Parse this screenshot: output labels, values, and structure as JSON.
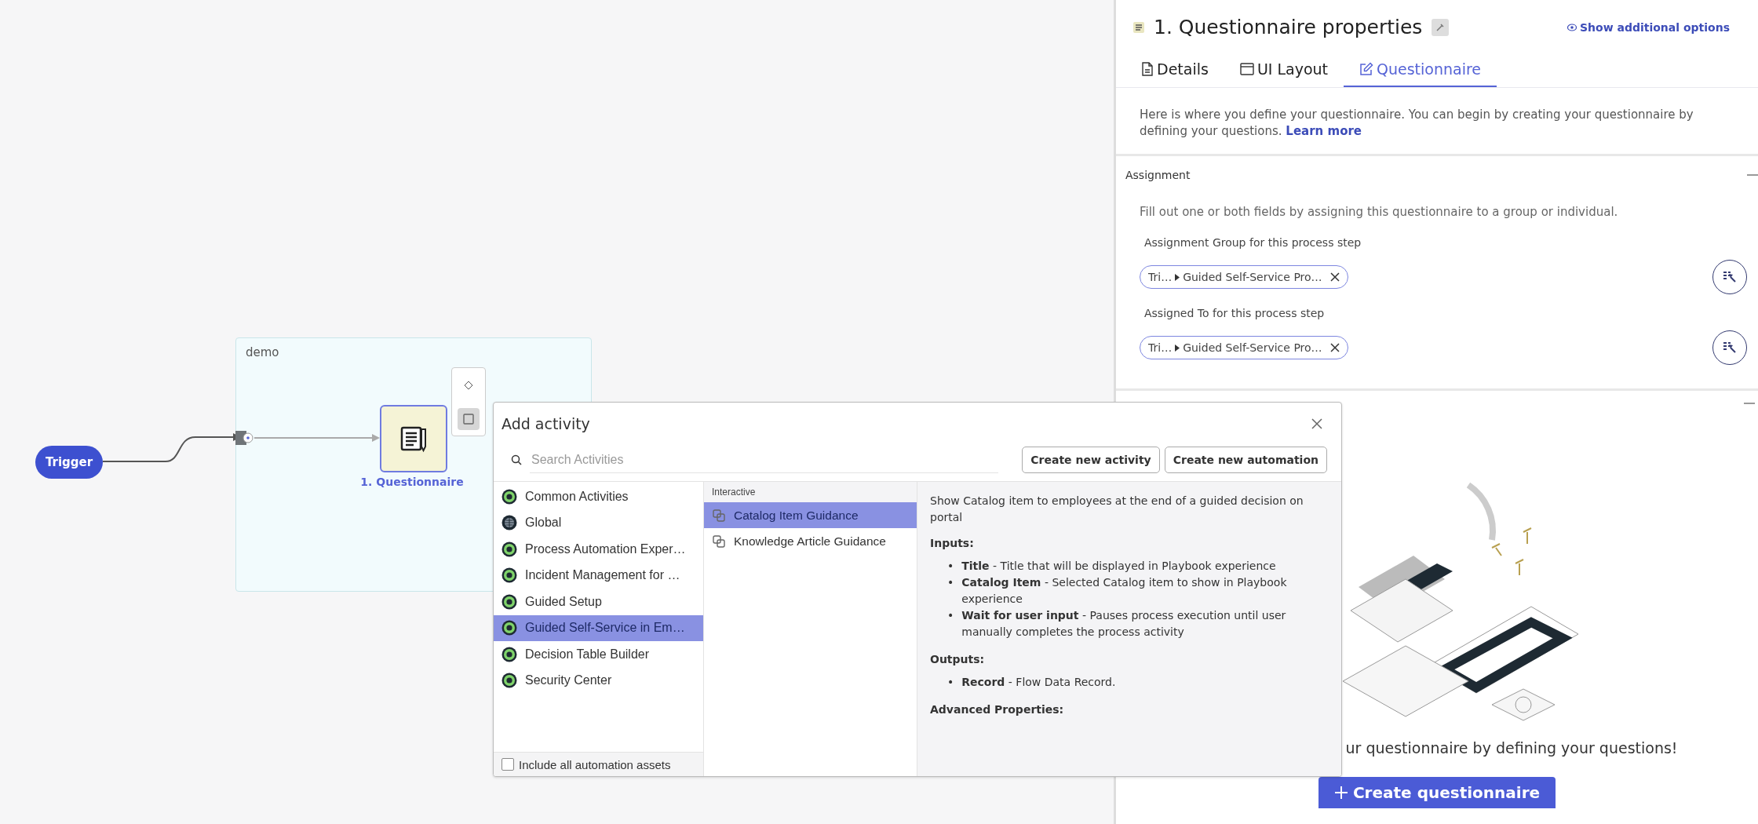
{
  "canvas": {
    "trigger": {
      "label": "Trigger"
    },
    "group": {
      "label": "demo"
    },
    "node": {
      "label": "1. Questionnaire",
      "selected": true
    }
  },
  "dialog": {
    "title": "Add activity",
    "search": {
      "placeholder": "Search Activities"
    },
    "buttons": [
      "Create new activity",
      "Create new automation"
    ],
    "categories": [
      {
        "label": "Common Activities",
        "kind": "app",
        "selected": false
      },
      {
        "label": "Global",
        "kind": "globe",
        "selected": false
      },
      {
        "label": "Process Automation Exper…",
        "kind": "app",
        "selected": false
      },
      {
        "label": "Incident Management for …",
        "kind": "app",
        "selected": false
      },
      {
        "label": "Guided Setup",
        "kind": "app",
        "selected": false
      },
      {
        "label": "Guided Self-Service in Em…",
        "kind": "app",
        "selected": true
      },
      {
        "label": "Decision Table Builder",
        "kind": "app",
        "selected": false
      },
      {
        "label": "Security Center",
        "kind": "app",
        "selected": false
      }
    ],
    "include_all": {
      "label": "Include all automation assets",
      "checked": false
    },
    "group_label": "Interactive",
    "activities": [
      {
        "label": "Catalog Item Guidance",
        "selected": true
      },
      {
        "label": "Knowledge Article Guidance",
        "selected": false
      }
    ],
    "details": {
      "marker": "•",
      "summary": "Show Catalog item to employees at the end of a guided decision on portal",
      "sections": [
        {
          "heading": "Inputs:",
          "items": [
            "**Title** - Title that will be displayed in Playbook experience",
            "**Catalog Item** - Selected Catalog item to show in Playbook experience",
            "**Wait for user input** - Pauses process execution until user manually completes the process activity"
          ]
        },
        {
          "heading": "Outputs:",
          "items": [
            "**Record** - Flow Data Record."
          ]
        },
        {
          "heading": "Advanced Properties:"
        }
      ]
    }
  },
  "properties": {
    "title": "1. Questionnaire properties",
    "show_options": "Show additional options",
    "tabs": [
      {
        "label": "Details",
        "kind": "details",
        "selected": false
      },
      {
        "label": "UI Layout",
        "kind": "layout",
        "selected": false
      },
      {
        "label": "Questionnaire",
        "kind": "edit",
        "selected": true
      }
    ],
    "intro": "Here is where you define your questionnaire. You can begin by creating your questionnaire by defining your questions.",
    "learn_more": "Learn more",
    "assignment": {
      "heading": "Assignment",
      "expanded": true,
      "hint": "Fill out one or both fields by assigning this questionnaire to a group or individual.",
      "fields": [
        {
          "label": "Assignment Group for this process step",
          "parent": "Tri…",
          "value": "Guided Self-Service Pro…"
        },
        {
          "label": "Assigned To for this process step",
          "parent": "Tri…",
          "value": "Guided Self-Service Pro…"
        }
      ]
    },
    "questionnaire": {
      "expanded": true,
      "empty_text": "ur questionnaire by defining your questions!",
      "button": "Create questionnaire"
    }
  }
}
